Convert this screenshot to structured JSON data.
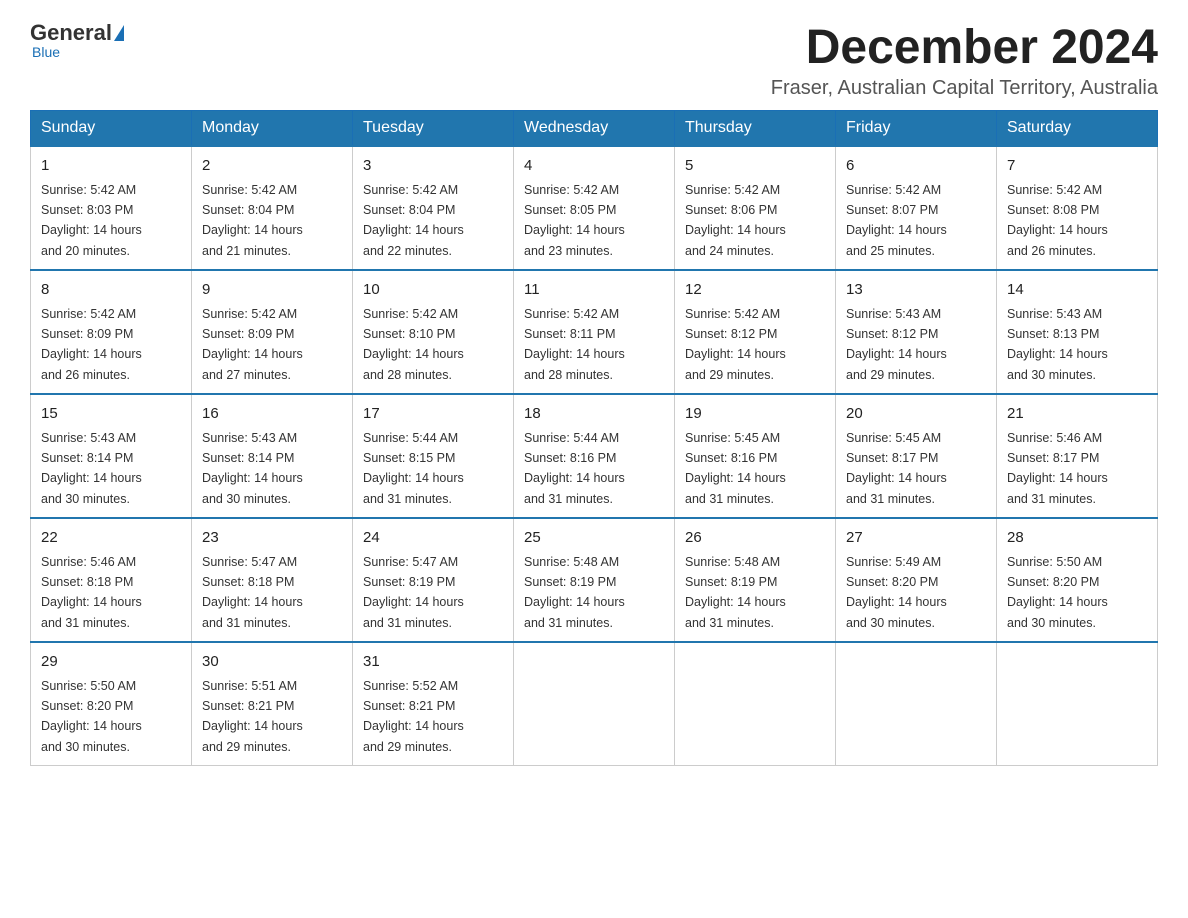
{
  "logo": {
    "general": "General",
    "triangle": "",
    "blue": "Blue",
    "sub": "Blue"
  },
  "header": {
    "month_year": "December 2024",
    "location": "Fraser, Australian Capital Territory, Australia"
  },
  "days_of_week": [
    "Sunday",
    "Monday",
    "Tuesday",
    "Wednesday",
    "Thursday",
    "Friday",
    "Saturday"
  ],
  "weeks": [
    [
      {
        "day": "1",
        "sunrise": "5:42 AM",
        "sunset": "8:03 PM",
        "daylight": "14 hours and 20 minutes."
      },
      {
        "day": "2",
        "sunrise": "5:42 AM",
        "sunset": "8:04 PM",
        "daylight": "14 hours and 21 minutes."
      },
      {
        "day": "3",
        "sunrise": "5:42 AM",
        "sunset": "8:04 PM",
        "daylight": "14 hours and 22 minutes."
      },
      {
        "day": "4",
        "sunrise": "5:42 AM",
        "sunset": "8:05 PM",
        "daylight": "14 hours and 23 minutes."
      },
      {
        "day": "5",
        "sunrise": "5:42 AM",
        "sunset": "8:06 PM",
        "daylight": "14 hours and 24 minutes."
      },
      {
        "day": "6",
        "sunrise": "5:42 AM",
        "sunset": "8:07 PM",
        "daylight": "14 hours and 25 minutes."
      },
      {
        "day": "7",
        "sunrise": "5:42 AM",
        "sunset": "8:08 PM",
        "daylight": "14 hours and 26 minutes."
      }
    ],
    [
      {
        "day": "8",
        "sunrise": "5:42 AM",
        "sunset": "8:09 PM",
        "daylight": "14 hours and 26 minutes."
      },
      {
        "day": "9",
        "sunrise": "5:42 AM",
        "sunset": "8:09 PM",
        "daylight": "14 hours and 27 minutes."
      },
      {
        "day": "10",
        "sunrise": "5:42 AM",
        "sunset": "8:10 PM",
        "daylight": "14 hours and 28 minutes."
      },
      {
        "day": "11",
        "sunrise": "5:42 AM",
        "sunset": "8:11 PM",
        "daylight": "14 hours and 28 minutes."
      },
      {
        "day": "12",
        "sunrise": "5:42 AM",
        "sunset": "8:12 PM",
        "daylight": "14 hours and 29 minutes."
      },
      {
        "day": "13",
        "sunrise": "5:43 AM",
        "sunset": "8:12 PM",
        "daylight": "14 hours and 29 minutes."
      },
      {
        "day": "14",
        "sunrise": "5:43 AM",
        "sunset": "8:13 PM",
        "daylight": "14 hours and 30 minutes."
      }
    ],
    [
      {
        "day": "15",
        "sunrise": "5:43 AM",
        "sunset": "8:14 PM",
        "daylight": "14 hours and 30 minutes."
      },
      {
        "day": "16",
        "sunrise": "5:43 AM",
        "sunset": "8:14 PM",
        "daylight": "14 hours and 30 minutes."
      },
      {
        "day": "17",
        "sunrise": "5:44 AM",
        "sunset": "8:15 PM",
        "daylight": "14 hours and 31 minutes."
      },
      {
        "day": "18",
        "sunrise": "5:44 AM",
        "sunset": "8:16 PM",
        "daylight": "14 hours and 31 minutes."
      },
      {
        "day": "19",
        "sunrise": "5:45 AM",
        "sunset": "8:16 PM",
        "daylight": "14 hours and 31 minutes."
      },
      {
        "day": "20",
        "sunrise": "5:45 AM",
        "sunset": "8:17 PM",
        "daylight": "14 hours and 31 minutes."
      },
      {
        "day": "21",
        "sunrise": "5:46 AM",
        "sunset": "8:17 PM",
        "daylight": "14 hours and 31 minutes."
      }
    ],
    [
      {
        "day": "22",
        "sunrise": "5:46 AM",
        "sunset": "8:18 PM",
        "daylight": "14 hours and 31 minutes."
      },
      {
        "day": "23",
        "sunrise": "5:47 AM",
        "sunset": "8:18 PM",
        "daylight": "14 hours and 31 minutes."
      },
      {
        "day": "24",
        "sunrise": "5:47 AM",
        "sunset": "8:19 PM",
        "daylight": "14 hours and 31 minutes."
      },
      {
        "day": "25",
        "sunrise": "5:48 AM",
        "sunset": "8:19 PM",
        "daylight": "14 hours and 31 minutes."
      },
      {
        "day": "26",
        "sunrise": "5:48 AM",
        "sunset": "8:19 PM",
        "daylight": "14 hours and 31 minutes."
      },
      {
        "day": "27",
        "sunrise": "5:49 AM",
        "sunset": "8:20 PM",
        "daylight": "14 hours and 30 minutes."
      },
      {
        "day": "28",
        "sunrise": "5:50 AM",
        "sunset": "8:20 PM",
        "daylight": "14 hours and 30 minutes."
      }
    ],
    [
      {
        "day": "29",
        "sunrise": "5:50 AM",
        "sunset": "8:20 PM",
        "daylight": "14 hours and 30 minutes."
      },
      {
        "day": "30",
        "sunrise": "5:51 AM",
        "sunset": "8:21 PM",
        "daylight": "14 hours and 29 minutes."
      },
      {
        "day": "31",
        "sunrise": "5:52 AM",
        "sunset": "8:21 PM",
        "daylight": "14 hours and 29 minutes."
      },
      null,
      null,
      null,
      null
    ]
  ],
  "labels": {
    "sunrise": "Sunrise:",
    "sunset": "Sunset:",
    "daylight": "Daylight:"
  }
}
